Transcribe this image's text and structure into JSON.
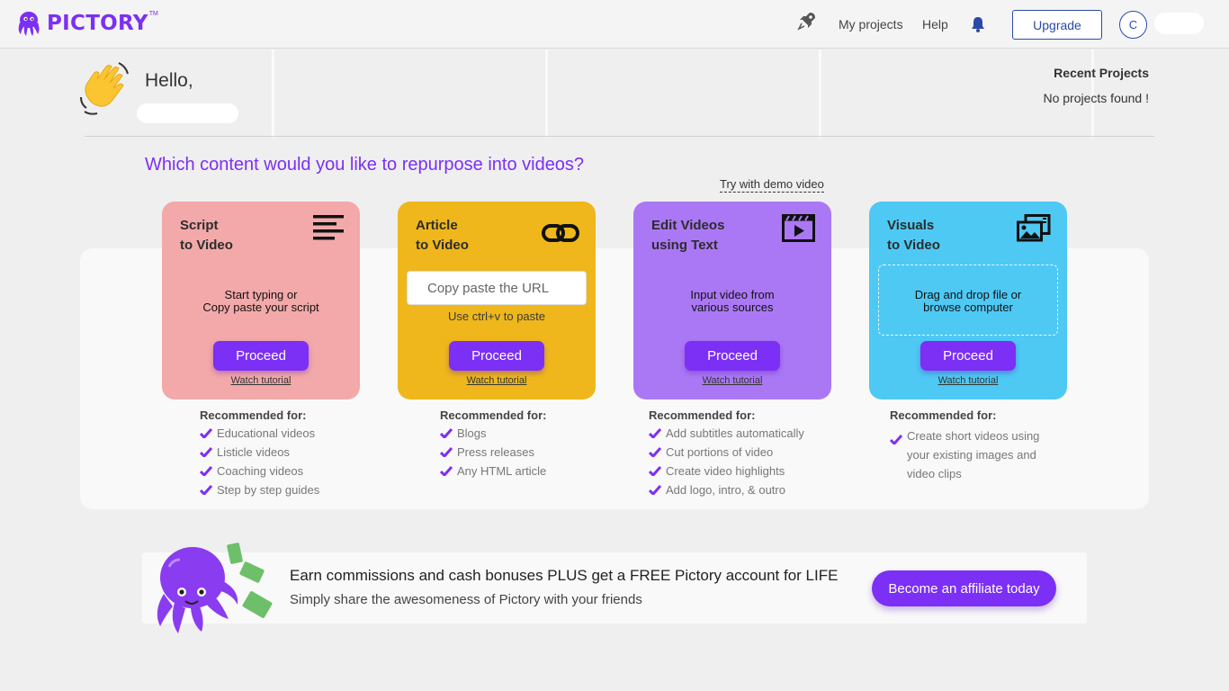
{
  "header": {
    "logo_text": "PICTORY",
    "logo_tm": "TM",
    "nav": {
      "my_projects": "My projects",
      "help": "Help"
    },
    "upgrade_label": "Upgrade",
    "avatar_initial": "C"
  },
  "greeting": {
    "hello": "Hello,"
  },
  "recent": {
    "title": "Recent Projects",
    "empty": "No projects found !"
  },
  "question": "Which content would you like to repurpose into videos?",
  "demo_link": "Try with demo video",
  "cards": [
    {
      "title1": "Script",
      "title2": "to Video",
      "desc1": "Start typing or",
      "desc2": "Copy paste your script",
      "proceed": "Proceed",
      "watch": "Watch tutorial",
      "color": "#f3a9a9",
      "icon": "lines-icon"
    },
    {
      "title1": "Article",
      "title2": "to Video",
      "input_placeholder": "Copy paste the URL",
      "hint": "Use ctrl+v to paste",
      "proceed": "Proceed",
      "watch": "Watch tutorial",
      "color": "#efb71b",
      "icon": "link-icon"
    },
    {
      "title1": "Edit Videos",
      "title2": "using Text",
      "desc1": "Input video from",
      "desc2": "various sources",
      "proceed": "Proceed",
      "watch": "Watch tutorial",
      "color": "#ab78f5",
      "icon": "clapper-icon"
    },
    {
      "title1": "Visuals",
      "title2": "to Video",
      "desc1": "Drag and drop file or",
      "desc2": "browse computer",
      "proceed": "Proceed",
      "watch": "Watch tutorial",
      "color": "#4ec9f4",
      "icon": "images-icon"
    }
  ],
  "recommended": [
    {
      "title": "Recommended for:",
      "items": [
        "Educational videos",
        "Listicle videos",
        "Coaching videos",
        "Step by step guides"
      ]
    },
    {
      "title": "Recommended for:",
      "items": [
        "Blogs",
        "Press releases",
        "Any HTML article"
      ]
    },
    {
      "title": "Recommended for:",
      "items": [
        "Add subtitles automatically",
        "Cut portions of video",
        "Create video highlights",
        "Add logo, intro, & outro"
      ]
    },
    {
      "title": "Recommended for:",
      "items": [
        "Create short videos using your existing images and video clips"
      ]
    }
  ],
  "affiliate": {
    "headline": "Earn commissions and cash bonuses PLUS get a FREE Pictory account for LIFE",
    "sub": "Simply share the awesomeness of Pictory with your friends",
    "button": "Become an affiliate today"
  },
  "colors": {
    "accent": "#7c2ff5",
    "upgrade_border": "#2b4aa8"
  }
}
